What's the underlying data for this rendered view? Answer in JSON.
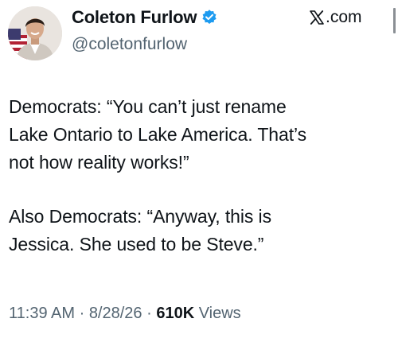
{
  "post": {
    "author": {
      "display_name": "Coleton Furlow",
      "handle": "@coletonfurlow",
      "verified": true,
      "verified_color": "#1d9bf0"
    },
    "source": {
      "label": ".com",
      "icon": "x-logo-icon"
    },
    "body": {
      "paragraph_1_line_1": "Democrats: “You can’t just rename",
      "paragraph_1_line_2": "Lake Ontario to Lake America. That’s",
      "paragraph_1_line_3": "not how reality works!”",
      "paragraph_2_line_1": "Also Democrats: “Anyway, this is",
      "paragraph_2_line_2": "Jessica. She used to be Steve.”"
    },
    "meta": {
      "time": "11:39 AM",
      "separator": " · ",
      "date": "8/28/26",
      "views_count": "610K",
      "views_label": " Views"
    }
  },
  "colors": {
    "text_primary": "#0f1419",
    "text_secondary": "#536471",
    "background": "#ffffff"
  }
}
